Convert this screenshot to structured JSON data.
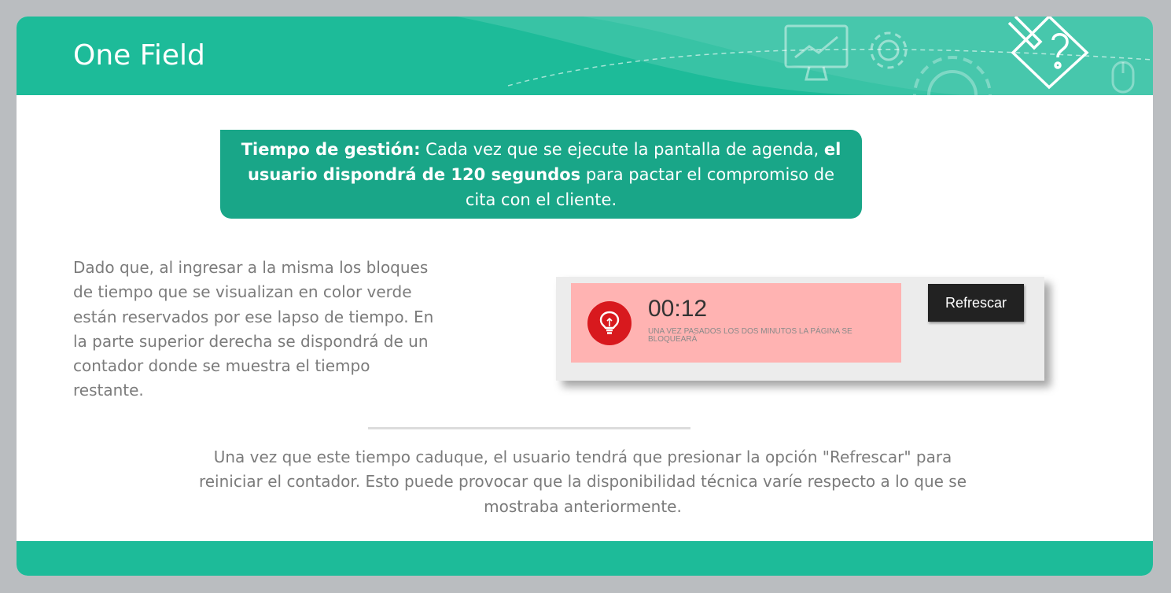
{
  "slide": {
    "title": "One Field"
  },
  "callout": {
    "label": "Tiempo de gestión:",
    "text_1": " Cada vez que se ejecute la pantalla de agenda, ",
    "bold_2": "el usuario dispondrá de 120 segundos",
    "text_3": " para pactar el compromiso de cita con el cliente."
  },
  "left_paragraph": "Dado que, al ingresar a la misma los bloques de tiempo que se visualizan en color verde están reservados por ese lapso de tiempo. En la parte superior derecha se dispondrá de un contador donde se muestra el tiempo restante.",
  "widget": {
    "counter": "00:12",
    "notice": "Una vez pasados los dos minutos la página se bloqueará",
    "refresh_label": "Refrescar",
    "icon": "lightbulb-icon"
  },
  "bottom_paragraph": "Una vez que este tiempo caduque, el usuario tendrá que presionar la opción \"Refrescar\" para reiniciar el contador. Esto puede provocar que la disponibilidad técnica varíe respecto a lo que se mostraba anteriormente.",
  "colors": {
    "header": "#1dbb99",
    "callout": "#19a688",
    "timer_background": "#ffb3b2",
    "bulb": "#d8191e",
    "button": "#222222",
    "body_text": "#7b7b7b"
  }
}
